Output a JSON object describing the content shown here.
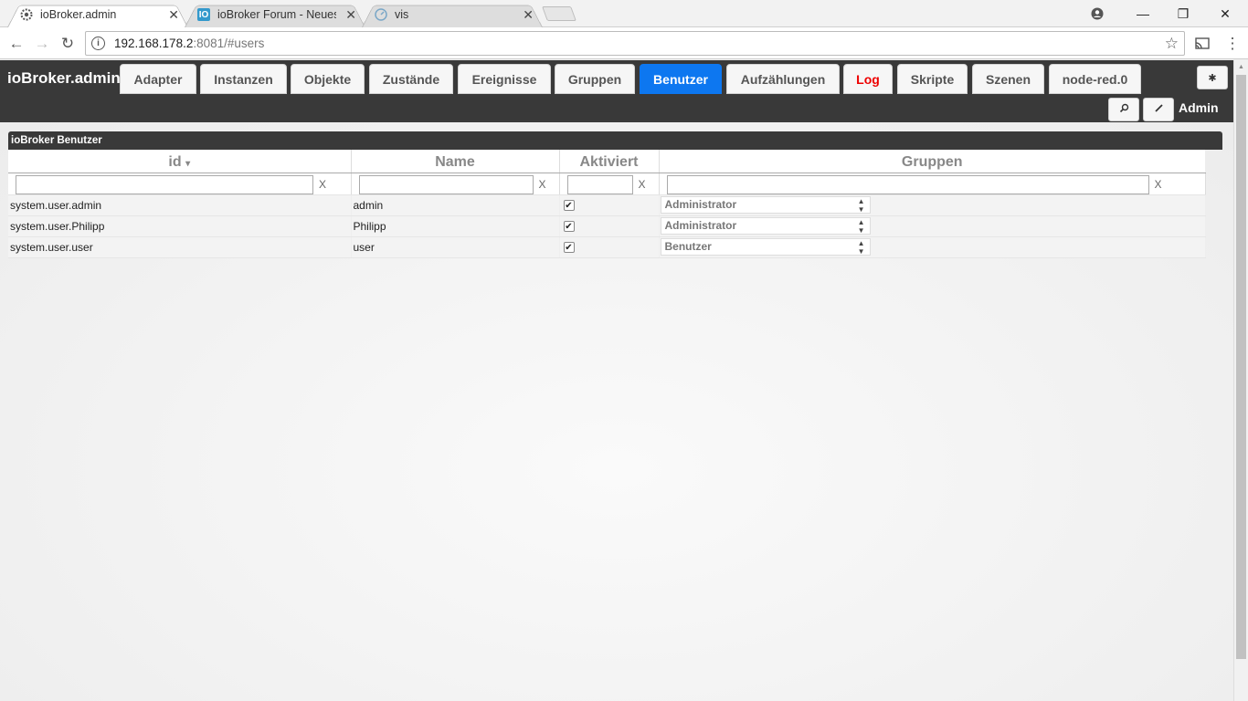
{
  "browser": {
    "tabs": [
      {
        "title": "ioBroker.admin",
        "icon": "gear-icon",
        "active": true
      },
      {
        "title": "ioBroker Forum - Neues",
        "icon": "iobroker-logo-icon",
        "active": false
      },
      {
        "title": "vis",
        "icon": "vis-gauge-icon",
        "active": false
      }
    ],
    "url_host": "192.168.178.2",
    "url_path": ":8081/#users"
  },
  "app": {
    "brand": "ioBroker.admin",
    "tabs": [
      {
        "label": "Adapter"
      },
      {
        "label": "Instanzen"
      },
      {
        "label": "Objekte"
      },
      {
        "label": "Zustände"
      },
      {
        "label": "Ereignisse"
      },
      {
        "label": "Gruppen"
      },
      {
        "label": "Benutzer"
      },
      {
        "label": "Aufzählungen"
      },
      {
        "label": "Log"
      },
      {
        "label": "Skripte"
      },
      {
        "label": "Szenen"
      },
      {
        "label": "node-red.0"
      }
    ],
    "active_tab": "Benutzer",
    "user_label": "Admin",
    "accent_color": "#0d77f0",
    "log_color": "#e00000"
  },
  "panel": {
    "title": "ioBroker Benutzer",
    "columns": {
      "id": "id",
      "name": "Name",
      "enabled": "Aktiviert",
      "groups": "Gruppen"
    },
    "filter_clear": "X",
    "rows": [
      {
        "id": "system.user.admin",
        "name": "admin",
        "enabled": true,
        "group": "Administrator"
      },
      {
        "id": "system.user.Philipp",
        "name": "Philipp",
        "enabled": true,
        "group": "Administrator"
      },
      {
        "id": "system.user.user",
        "name": "user",
        "enabled": true,
        "group": "Benutzer"
      }
    ]
  }
}
